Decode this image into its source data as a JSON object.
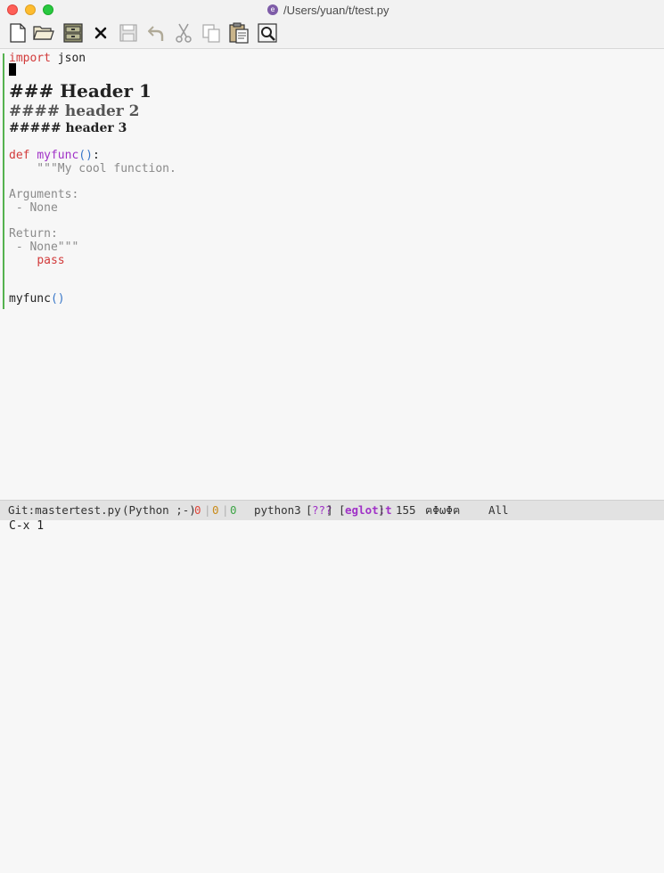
{
  "window": {
    "title": "/Users/yuan/t/test.py",
    "doc_icon_glyph": "e"
  },
  "toolbar": {
    "items": [
      "new-file-icon",
      "open-folder-icon",
      "file-cabinet-icon",
      "close-icon",
      "save-icon",
      "undo-icon",
      "cut-icon",
      "copy-icon",
      "paste-icon",
      "search-icon"
    ]
  },
  "editor": {
    "line1_kw": "import",
    "line1_rest": " json",
    "h1": "### Header 1",
    "h2": "#### header 2",
    "h3": "##### header 3",
    "def_kw": "def",
    "func_name": "myfunc",
    "def_parens": "()",
    "def_colon": ":",
    "doc1": "    \"\"\"My cool function.",
    "doc2": "Arguments:",
    "doc3": " - None",
    "doc4": "Return:",
    "doc5": " - None\"\"\"",
    "pass_indent": "    ",
    "pass_kw": "pass",
    "call_name": "myfunc",
    "call_parens": "()"
  },
  "modeline": {
    "git": "Git:master",
    "file": "test.py",
    "mode": "(Python ;-)",
    "err": "0",
    "warn": "0",
    "note": "0",
    "sep1": "|",
    "sep2": "|",
    "venv": "python3",
    "unknown_open": "[",
    "unknown": "???",
    "unknown_close": "]",
    "eglot_open": "[",
    "eglot": "eglot:t",
    "eglot_close": "]",
    "line_no": "155",
    "glyphs": "ฅΦωΦฅ",
    "position": "All"
  },
  "echo": {
    "text": "C-x 1"
  },
  "colors": {
    "keyword": "#d23b3b",
    "function": "#a031c7",
    "paren": "#3a78c9",
    "docstring": "#8a8a8a",
    "gutter": "#55b24f"
  }
}
